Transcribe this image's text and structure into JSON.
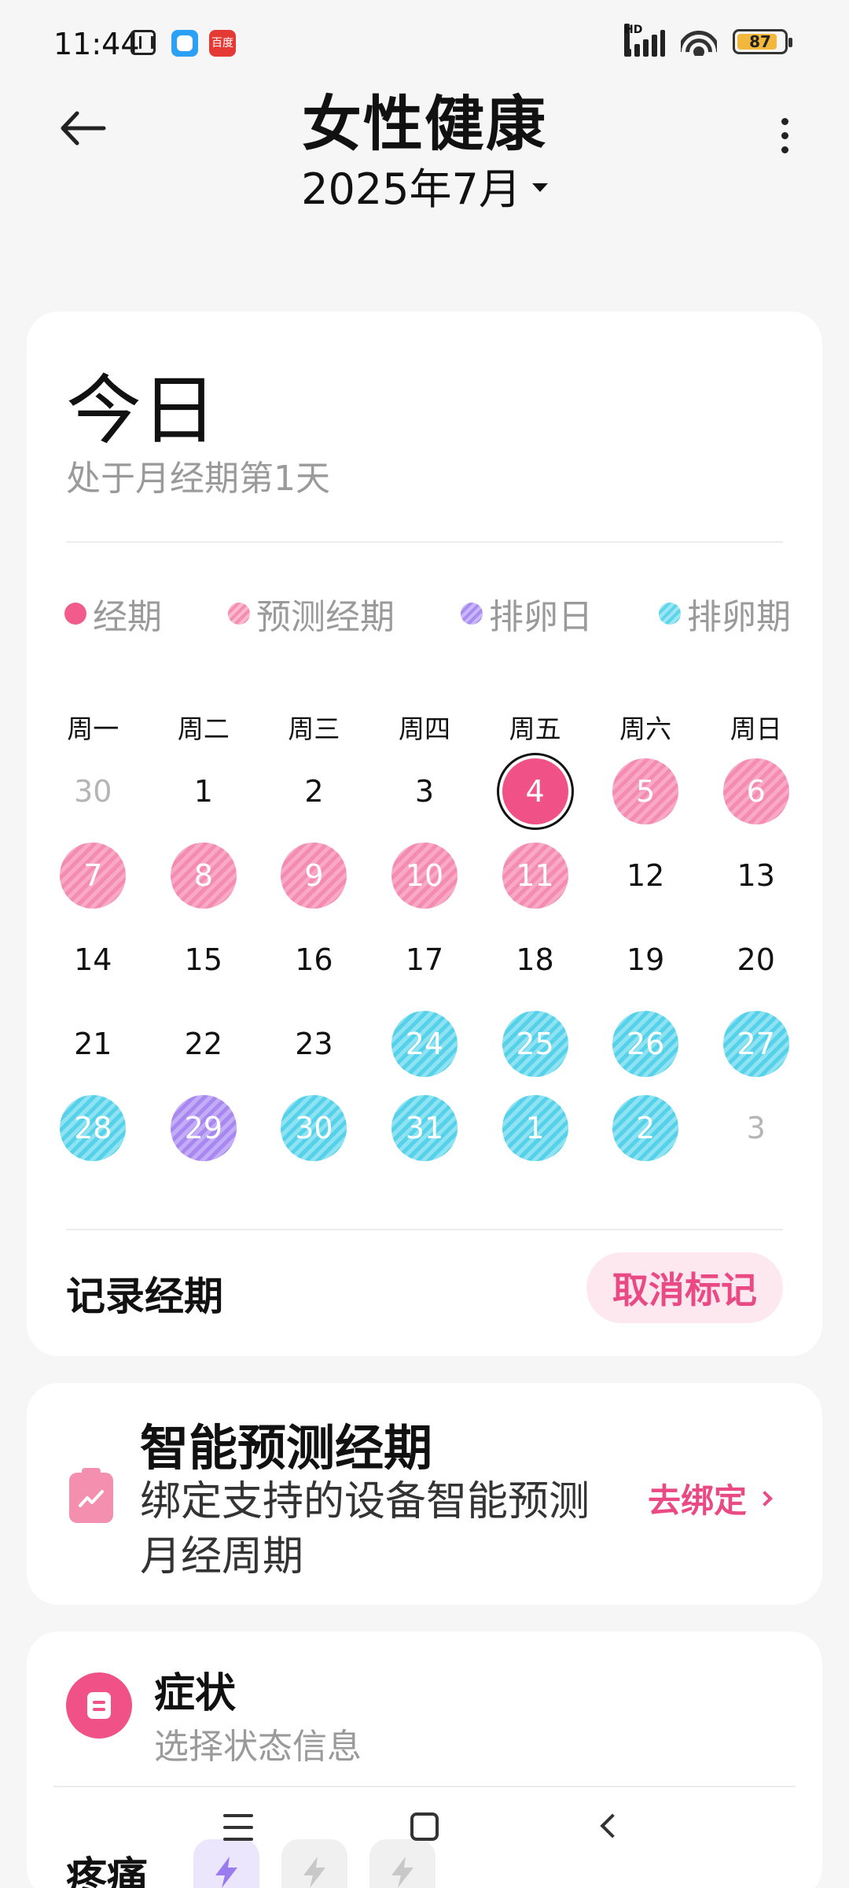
{
  "status_bar": {
    "time": "11:44",
    "battery_level": "87",
    "signal_label": "HD",
    "app2_label": "百度"
  },
  "header": {
    "title": "女性健康",
    "month": "2025年7月"
  },
  "today_card": {
    "title": "今日",
    "subtitle": "处于月经期第1天",
    "legend": [
      {
        "label": "经期",
        "color": "#f25c8c"
      },
      {
        "label": "预测经期",
        "color": "#f58fb2"
      },
      {
        "label": "排卵日",
        "color": "#a98cf0"
      },
      {
        "label": "排卵期",
        "color": "#5fd4ea"
      }
    ],
    "weekdays": [
      "周一",
      "周二",
      "周三",
      "周四",
      "周五",
      "周六",
      "周日"
    ],
    "days": [
      {
        "label": "30",
        "state": "muted"
      },
      {
        "label": "1",
        "state": "normal"
      },
      {
        "label": "2",
        "state": "normal"
      },
      {
        "label": "3",
        "state": "normal"
      },
      {
        "label": "4",
        "state": "period-today"
      },
      {
        "label": "5",
        "state": "predicted"
      },
      {
        "label": "6",
        "state": "predicted"
      },
      {
        "label": "7",
        "state": "predicted"
      },
      {
        "label": "8",
        "state": "predicted"
      },
      {
        "label": "9",
        "state": "predicted"
      },
      {
        "label": "10",
        "state": "predicted"
      },
      {
        "label": "11",
        "state": "predicted"
      },
      {
        "label": "12",
        "state": "normal"
      },
      {
        "label": "13",
        "state": "normal"
      },
      {
        "label": "14",
        "state": "normal"
      },
      {
        "label": "15",
        "state": "normal"
      },
      {
        "label": "16",
        "state": "normal"
      },
      {
        "label": "17",
        "state": "normal"
      },
      {
        "label": "18",
        "state": "normal"
      },
      {
        "label": "19",
        "state": "normal"
      },
      {
        "label": "20",
        "state": "normal"
      },
      {
        "label": "21",
        "state": "normal"
      },
      {
        "label": "22",
        "state": "normal"
      },
      {
        "label": "23",
        "state": "normal"
      },
      {
        "label": "24",
        "state": "ovulation"
      },
      {
        "label": "25",
        "state": "ovulation"
      },
      {
        "label": "26",
        "state": "ovulation"
      },
      {
        "label": "27",
        "state": "ovulation"
      },
      {
        "label": "28",
        "state": "ovulation"
      },
      {
        "label": "29",
        "state": "ovulation-day"
      },
      {
        "label": "30",
        "state": "ovulation"
      },
      {
        "label": "31",
        "state": "ovulation"
      },
      {
        "label": "1",
        "state": "ovulation"
      },
      {
        "label": "2",
        "state": "ovulation"
      },
      {
        "label": "3",
        "state": "muted"
      }
    ],
    "record_label": "记录经期",
    "cancel_button": "取消标记"
  },
  "predict_card": {
    "title": "智能预测经期",
    "description": "绑定支持的设备智能预测月经周期",
    "link": "去绑定"
  },
  "symptom_card": {
    "title": "症状",
    "subtitle": "选择状态信息",
    "pain_label": "疼痛"
  }
}
